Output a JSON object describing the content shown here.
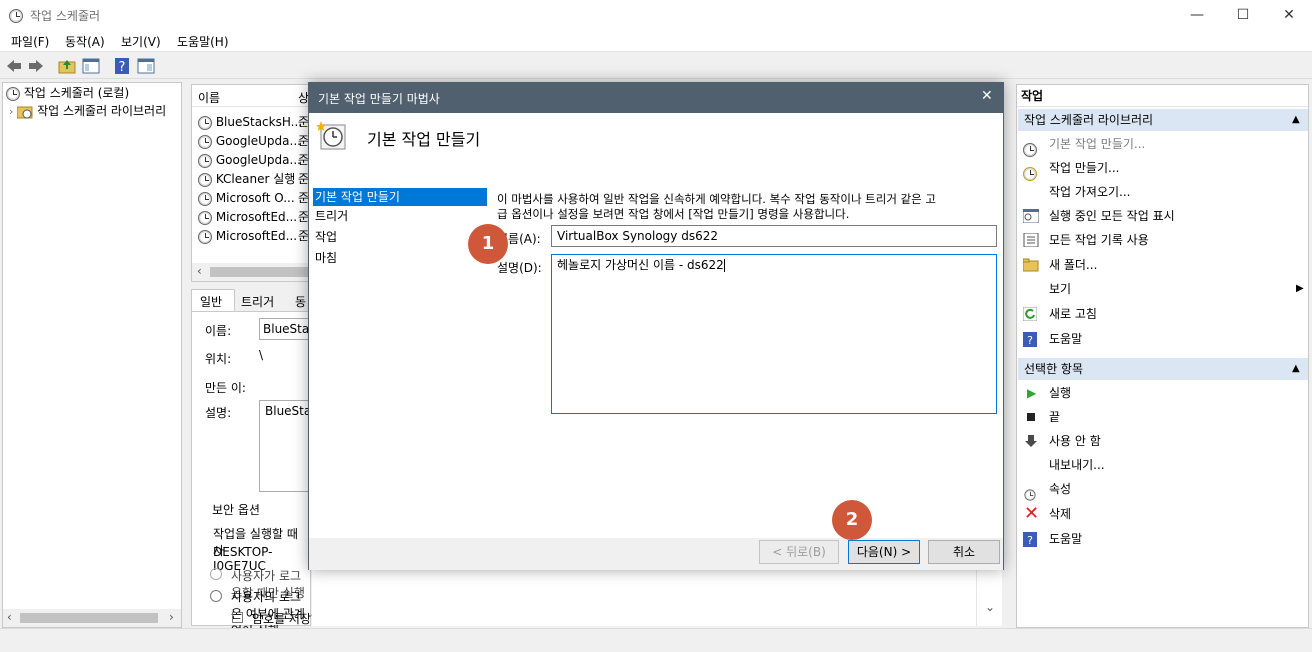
{
  "window": {
    "title": "작업 스케줄러",
    "minimize": "—",
    "maximize": "☐",
    "close": "✕"
  },
  "menu": [
    "파일(F)",
    "동작(A)",
    "보기(V)",
    "도움말(H)"
  ],
  "tree": {
    "root": "작업 스케줄러 (로컬)",
    "library": "작업 스케줄러 라이브러리"
  },
  "list": {
    "header": "이름",
    "header2": "상",
    "rows": [
      {
        "name": "BlueStacksH...",
        "status": "준"
      },
      {
        "name": "GoogleUpda...",
        "status": "준"
      },
      {
        "name": "GoogleUpda...",
        "status": "준"
      },
      {
        "name": "KCleaner 실행",
        "status": "준"
      },
      {
        "name": "Microsoft O...",
        "status": "준"
      },
      {
        "name": "MicrosoftEd...",
        "status": "준"
      },
      {
        "name": "MicrosoftEd...",
        "status": "준"
      }
    ]
  },
  "detail": {
    "tabs": [
      "일반",
      "트리거",
      "동"
    ],
    "name_label": "이름:",
    "name_value": "BlueStac",
    "location_label": "위치:",
    "location_value": "\\",
    "author_label": "만든 이:",
    "desc_label": "설명:",
    "desc_value": "BlueStac",
    "security_title": "보안 옵션",
    "security_text": "작업을 실행할 때 사",
    "account": "DESKTOP-I0GE7UC",
    "radio1": "사용자가 로그온할 때만 실행",
    "radio2": "사용자의 로그온 여부에 관계없이 실행",
    "check1": "암호를 저장하지 않습니다. 이 작업은 로컬 리소스에만 액세스할 수 있습니다."
  },
  "dialog": {
    "title": "기본 작업 만들기 마법사",
    "header": "기본 작업 만들기",
    "steps": [
      "기본 작업 만들기",
      "트리거",
      "작업",
      "마침"
    ],
    "intro": "이 마법사를 사용하여 일반 작업을 신속하게 예약합니다. 복수 작업 동작이나 트리거 같은 고급 옵션이나 설정을 보려면 작업 창에서 [작업 만들기] 명령을 사용합니다.",
    "intro_line1": "이 마법사를 사용하여 일반 작업을 신속하게 예약합니다. 복수 작업 동작이나 트리거 같은 고",
    "intro_line2": "급 옵션이나 설정을 보려면 작업 창에서 [작업 만들기] 명령을 사용합니다.",
    "name_label": "이름(A):",
    "name_value": "VirtualBox Synology ds622",
    "desc_label": "설명(D):",
    "desc_value": "헤놀로지 가상머신 이름 - ds622",
    "back": "< 뒤로(B)",
    "next": "다음(N) >",
    "cancel": "취소",
    "close": "✕"
  },
  "badges": [
    "1",
    "2"
  ],
  "actions": {
    "title": "작업",
    "section1": "작업 스케줄러 라이브러리",
    "items1": [
      "기본 작업 만들기...",
      "작업 만들기...",
      "작업 가져오기...",
      "실행 중인 모든 작업 표시",
      "모든 작업 기록 사용",
      "새 폴더...",
      "보기",
      "새로 고침",
      "도움말"
    ],
    "section2": "선택한 항목",
    "items2": [
      "실행",
      "끝",
      "사용 안 함",
      "내보내기...",
      "속성",
      "삭제",
      "도움말"
    ]
  },
  "colors": {
    "dialog_title_bg": "#51606f",
    "selection": "#0078d7",
    "badge": "#d0583a",
    "section_bg": "#dbe6f4"
  }
}
